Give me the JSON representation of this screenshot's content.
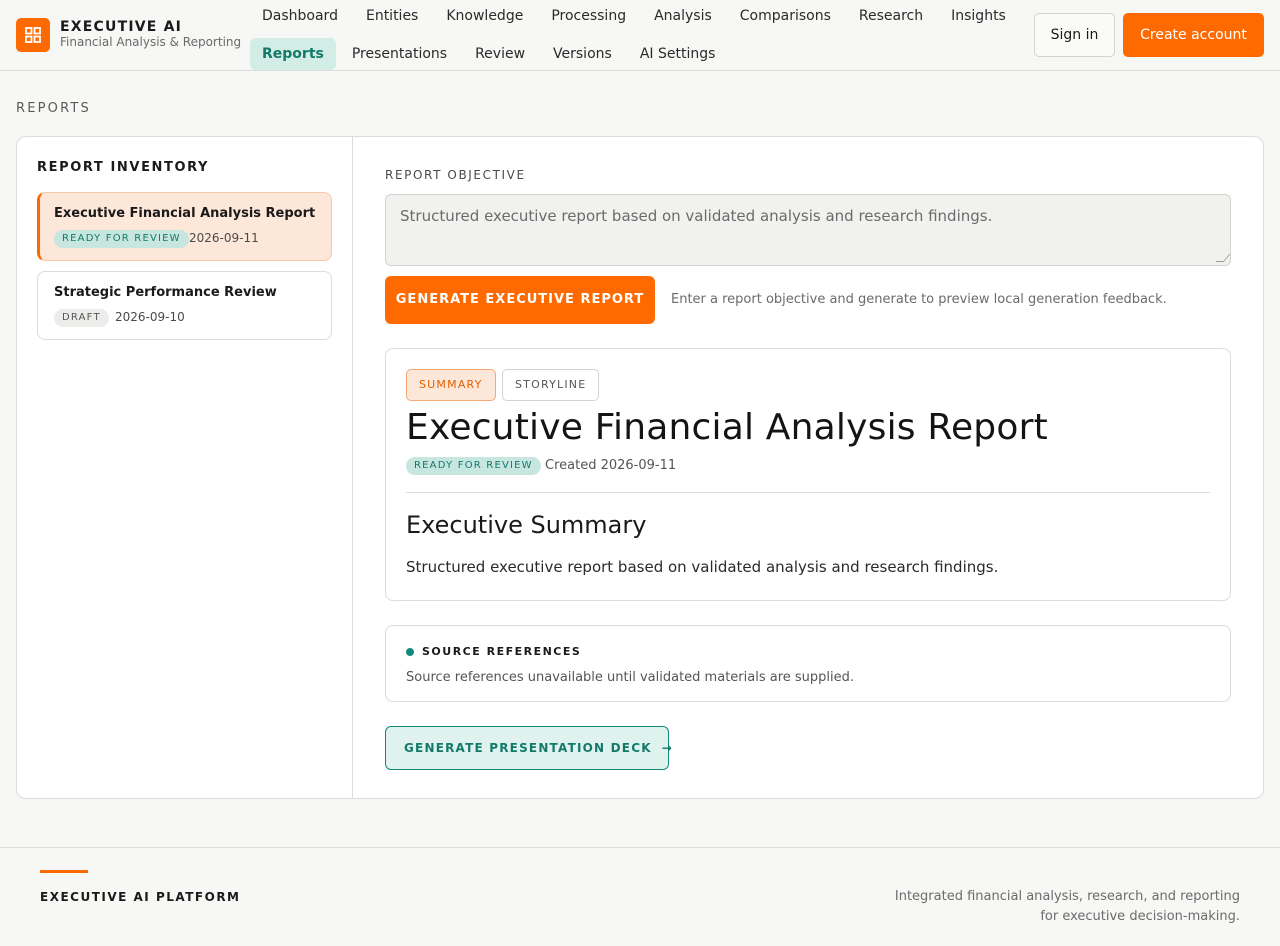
{
  "brand": {
    "title": "EXECUTIVE AI",
    "subtitle": "Financial Analysis & Reporting",
    "logo_icon": "grid-icon",
    "accent_color": "#ff6a00"
  },
  "nav": {
    "row1": [
      "Dashboard",
      "Entities",
      "Knowledge",
      "Processing",
      "Analysis",
      "Comparisons",
      "Research",
      "Insights"
    ],
    "row2": [
      "Reports",
      "Presentations",
      "Review",
      "Versions",
      "AI Settings"
    ],
    "active": "Reports"
  },
  "auth": {
    "sign_in": "Sign in",
    "create_account": "Create account"
  },
  "page": {
    "section_label": "REPORTS"
  },
  "inventory": {
    "title": "REPORT INVENTORY",
    "items": [
      {
        "title": "Executive Financial Analysis Report",
        "status": "READY FOR REVIEW",
        "date": "2026-09-11",
        "selected": true
      },
      {
        "title": "Strategic Performance Review",
        "status": "DRAFT",
        "date": "2026-09-10",
        "selected": false
      }
    ]
  },
  "objective": {
    "label": "REPORT OBJECTIVE",
    "value": "Structured executive report based on validated analysis and research findings.",
    "generate_button": "GENERATE EXECUTIVE REPORT",
    "hint": "Enter a report objective and generate to preview local generation feedback."
  },
  "report": {
    "tabs": [
      "SUMMARY",
      "STORYLINE"
    ],
    "active_tab": "SUMMARY",
    "title": "Executive Financial Analysis Report",
    "status": "READY FOR REVIEW",
    "created": "Created 2026-09-11",
    "section_heading": "Executive Summary",
    "body": "Structured executive report based on validated analysis and research findings."
  },
  "sources": {
    "title": "SOURCE REFERENCES",
    "text": "Source references unavailable until validated materials are supplied.",
    "status_color": "#13897a"
  },
  "deck_button": {
    "label": "GENERATE PRESENTATION DECK",
    "arrow": "→"
  },
  "footer": {
    "title": "EXECUTIVE AI PLATFORM",
    "text": "Integrated financial analysis, research, and reporting for executive decision-making."
  }
}
